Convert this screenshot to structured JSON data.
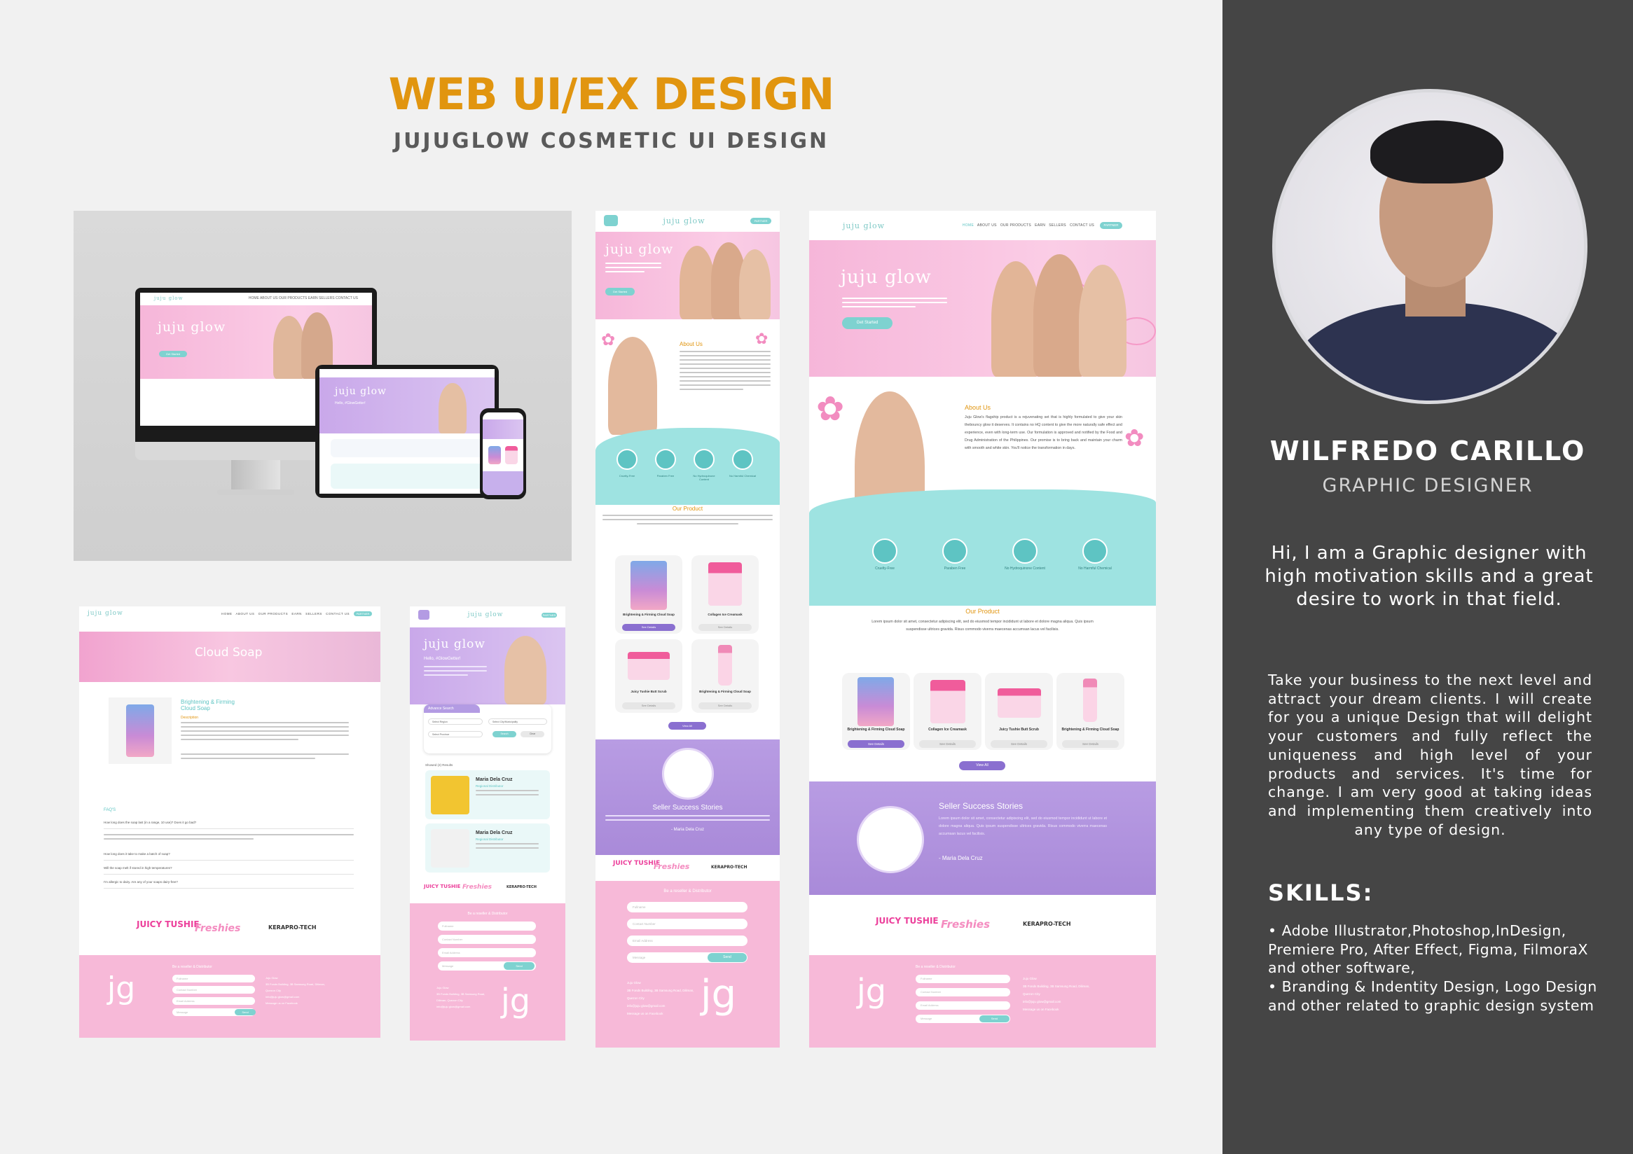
{
  "header": {
    "title": "WEB UI/EX DESIGN",
    "subtitle": "JUJUGLOW COSMETIC UI DESIGN"
  },
  "colors": {
    "accent_orange": "#e1950f",
    "side_bg": "#454545",
    "pink": "#f7b9d8",
    "lavender": "#b89ce3",
    "teal": "#9ee3e1"
  },
  "profile": {
    "name": "WILFREDO CARILLO",
    "role": "GRAPHIC DESIGNER",
    "intro": "Hi, I am a Graphic designer with high motivation skills and a great desire to work in that field.",
    "body": "Take your business to the next level and attract your dream clients. I will create for you a unique Design that will delight your customers and fully reflect the uniqueness and high level of your products and services. It's time for change. I am very good at taking ideas and implementing them creatively into any type of design.",
    "skills_title": "SKILLS:",
    "skills": [
      "• Adobe Illustrator,Photoshop,InDesign, Premiere Pro, After Effect, Figma, FilmoraX and other software,",
      "• Branding & Indentity Design, Logo Design and other related to graphic design system"
    ]
  },
  "site": {
    "logo": "juju glow",
    "hero_logo": "juju glow",
    "hero_text": "Lorem ipsum dolor sit amet, consectetur adipiscing elit, sed do eiusmod tempor incididunt ut labore et dolore magna aliqua.",
    "get_started": "Get Started",
    "nav": [
      "HOME",
      "ABOUT US",
      "OUR PRODUCTS",
      "EARN",
      "SELLERS",
      "CONTACT US"
    ],
    "partner": "PARTNER",
    "about_title": "About Us",
    "about_text": "Juju Glow's flagship product is a rejuvenating set that is highly formulated to give your skin thebouncy glow it deserves. It contains no HQ content to give the more naturally safe effect and experience, even with long-term use. Our formulation is approved and notified by the Food and Drug Administration of the Philippines. Our promise is to bring back and maintain your charm with smooth and white skin. You'll notice the transformation in days.",
    "features": [
      "Cruelty-Free",
      "Paraben Free",
      "No Hydroquinone Content",
      "No Harmful Chemical"
    ],
    "product_title": "Our Product",
    "product_text": "Lorem ipsum dolor sit amet, consectetur adipiscing elit, sed do eiusmod tempor incididunt ut labore et dolore magna aliqua. Quis ipsum suspendisse ultrices gravida. Risus commodo viverra maecenas accumsan lacus vel facilisis.",
    "products": [
      {
        "name": "Brightening & Firming Cloud Soap",
        "cta": "See Details"
      },
      {
        "name": "Collagen Ice Creamask",
        "cta": "See Details"
      },
      {
        "name": "Juicy Tushie Butt Scrub",
        "cta": "See Details"
      },
      {
        "name": "Brightening & Firming Cloud Soap",
        "cta": "See Details"
      }
    ],
    "view_all": "View All",
    "seller_title": "Seller Success Stories",
    "seller_text": "Lorem ipsum dolor sit amet, consectetur adipiscing elit, sed do eiusmod tempor incididunt ut labore et dolore magna aliqua. Quis ipsum suspendisse ultrices gravida. Risus commodo viverra maecenas accumsan lacus vel facilisis.",
    "seller_name": "- Maria Dela Cruz",
    "brands": [
      "JUICY TUSHIE",
      "Freshies",
      "KERAPRO-TECH"
    ],
    "reseller_title": "Be a reseller & Distributor",
    "form": {
      "fullname": "Fullname",
      "contact": "Contact Number",
      "email": "Email Address",
      "message": "Message",
      "send": "Send"
    },
    "contact_lines": [
      "Juju Glow",
      "3B Fonds Building, 3B Samsung Road, Diliman, Quezon City",
      "info@juju glow@gmail.com",
      "Message us on Facebook"
    ],
    "footer_logo": "jg",
    "cloud_soap": "Cloud Soap",
    "detail_title": "Brightening & Firming Cloud Soap",
    "detail_desc": "Description",
    "faq_title": "FAQ'S",
    "faqs": [
      "How long does the soap last (in a range, 10 use)? Does it go bad?",
      "How long does it take to make a batch of soap?",
      "Will the soap melt if stored in high temperatures?",
      "I'm allergic to dairy. Are any of your soaps dairy-free?"
    ],
    "greeting": "Hello, #GlowGetter!",
    "advance_search": "Advance Search",
    "select_region": "Select Region",
    "select_city": "Select City/Municipality",
    "select_province": "Select Province",
    "search": "Search",
    "clear": "Clear",
    "showed_results": "Showed (2) Results",
    "dist_name": "Maria Dela Cruz",
    "dist_role": "Regional Distributor"
  }
}
